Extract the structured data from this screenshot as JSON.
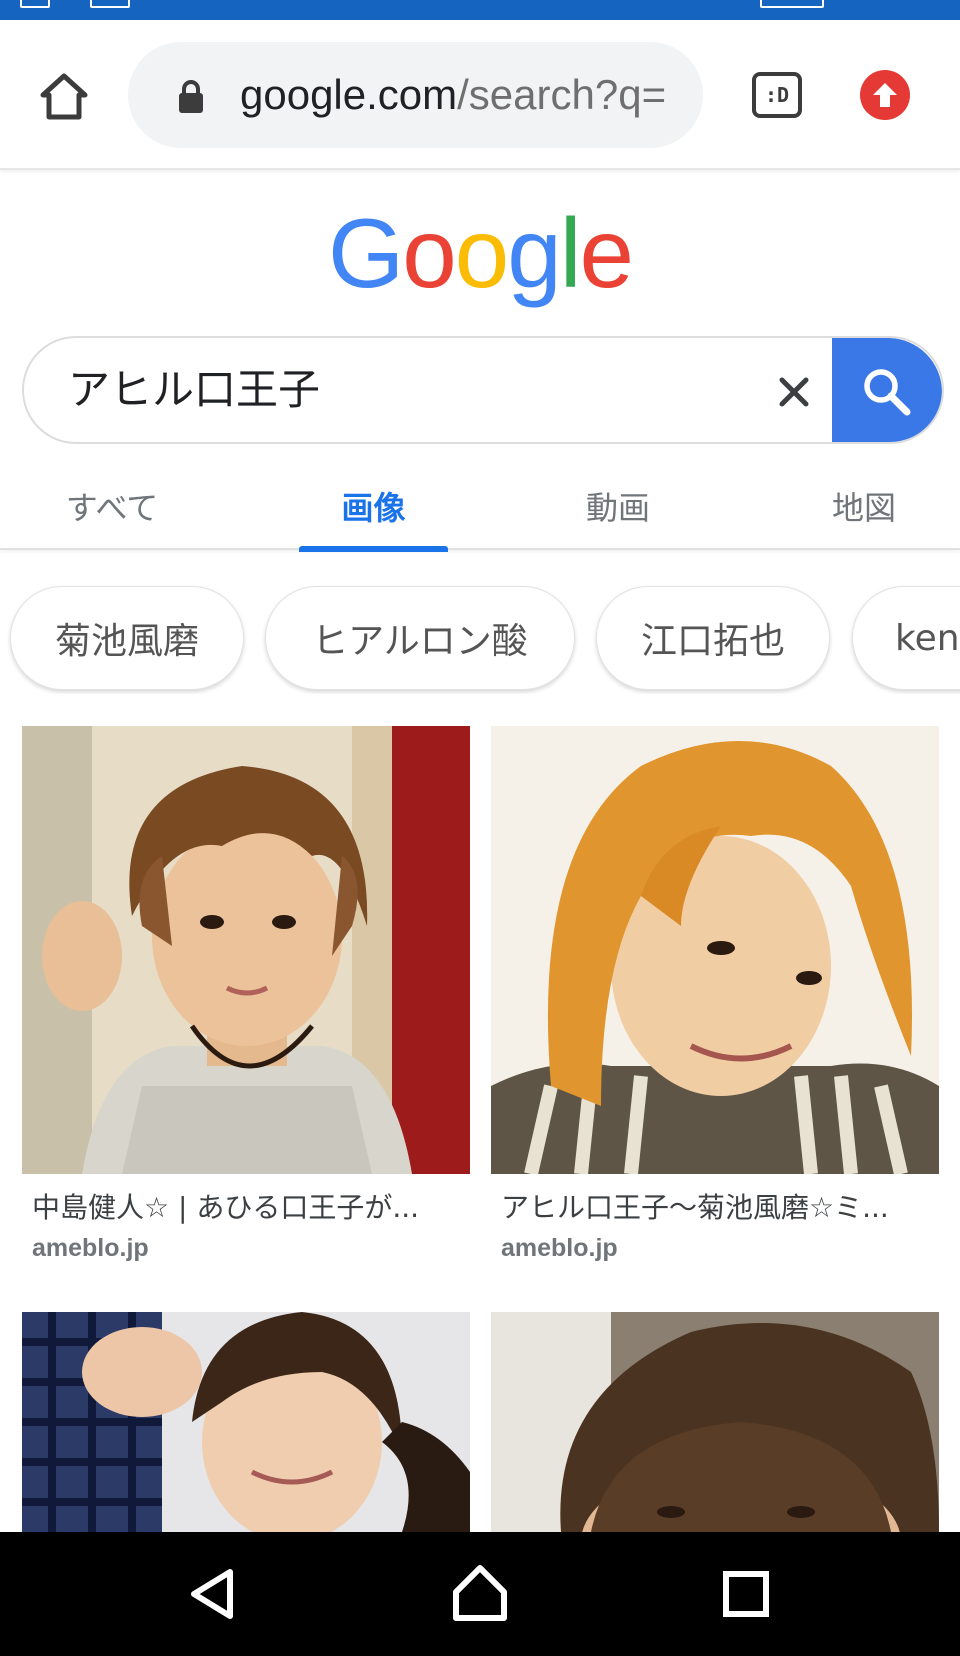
{
  "browser": {
    "url_domain": "google.com",
    "url_path": "/search?q=",
    "tab_switcher_label": ":D"
  },
  "google_logo": {
    "letters": [
      {
        "char": "G",
        "color": "#4285f4"
      },
      {
        "char": "o",
        "color": "#ea4335"
      },
      {
        "char": "o",
        "color": "#fbbc05"
      },
      {
        "char": "g",
        "color": "#4285f4"
      },
      {
        "char": "l",
        "color": "#34a853"
      },
      {
        "char": "e",
        "color": "#ea4335"
      }
    ]
  },
  "search": {
    "query": "アヒル口王子"
  },
  "tabs": [
    {
      "label": "すべて",
      "active": false
    },
    {
      "label": "画像",
      "active": true
    },
    {
      "label": "動画",
      "active": false
    },
    {
      "label": "地図",
      "active": false
    }
  ],
  "chips": [
    {
      "label": "菊池風磨"
    },
    {
      "label": "ヒアルロン酸"
    },
    {
      "label": "江口拓也"
    },
    {
      "label": "kenn"
    }
  ],
  "results": [
    {
      "title": "中島健人☆ | あひる口王子が...",
      "source": "ameblo.jp"
    },
    {
      "title": "アヒル口王子～菊池風磨☆ミ...",
      "source": "ameblo.jp"
    }
  ],
  "colors": {
    "accent": "#1a73e8",
    "search_button": "#3b78e7",
    "status_bar": "#1565c0",
    "update_badge": "#e53935"
  }
}
